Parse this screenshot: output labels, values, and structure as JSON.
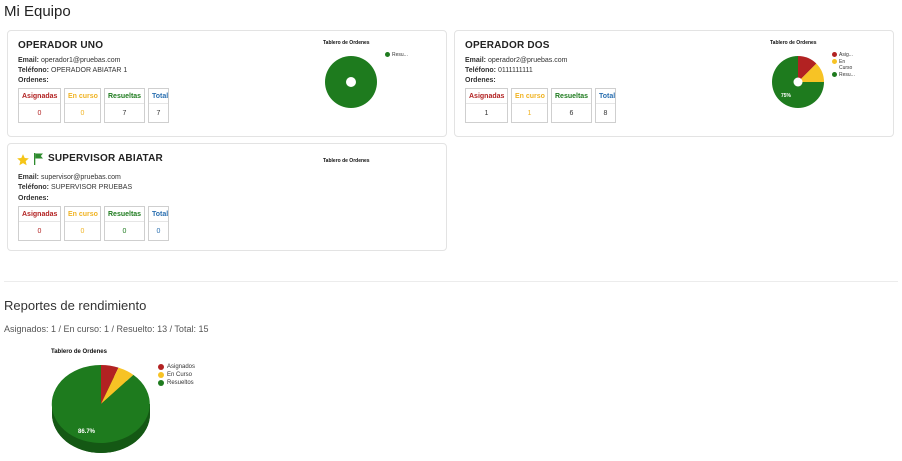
{
  "page": {
    "title": "Mi Equipo"
  },
  "labels": {
    "email": "Email:",
    "telefono": "Teléfono:",
    "ordenes": "Ordenes:",
    "asignadas": "Asignadas",
    "en_curso": "En curso",
    "resueltas": "Resueltas",
    "total": "Total"
  },
  "colors": {
    "asignados": "#b22222",
    "en_curso": "#f7c325",
    "resueltos": "#1e7b1e",
    "total": "#2a6fb0"
  },
  "operators": [
    {
      "name": "OPERADOR UNO",
      "email": "operador1@pruebas.com",
      "telefono": "OPERADOR ABIATAR 1",
      "asignadas": "0",
      "en_curso": "0",
      "resueltas": "7",
      "total": "7",
      "chart": {
        "title": "Tablero de Ordenes",
        "legend": [
          "Resu..."
        ],
        "pct_label": ""
      }
    },
    {
      "name": "OPERADOR DOS",
      "email": "operador2@pruebas.com",
      "telefono": "0111111111",
      "asignadas": "1",
      "en_curso": "1",
      "resueltas": "6",
      "total": "8",
      "chart": {
        "title": "Tablero de Ordenes",
        "legend": [
          "Asig...",
          "En Curso",
          "Resu..."
        ],
        "pct_label": "75%"
      }
    },
    {
      "name": "SUPERVISOR ABIATAR",
      "email": "supervisor@pruebas.com",
      "telefono": "SUPERVISOR PRUEBAS",
      "asignadas": "0",
      "en_curso": "0",
      "resueltas": "0",
      "total": "0",
      "chart": {
        "title": "Tablero de Ordenes",
        "legend": [],
        "pct_label": ""
      }
    }
  ],
  "reports": {
    "title": "Reportes de rendimiento",
    "summary": "Asignados: 1 / En curso: 1 / Resuelto: 13 / Total: 15"
  },
  "chart_data": [
    {
      "type": "pie",
      "title": "Tablero de Ordenes",
      "categories": [
        "Resueltos"
      ],
      "values": [
        7
      ]
    },
    {
      "type": "pie",
      "title": "Tablero de Ordenes",
      "categories": [
        "Asignados",
        "En Curso",
        "Resueltos"
      ],
      "values": [
        1,
        1,
        6
      ],
      "data_labels": [
        "75%"
      ]
    },
    {
      "type": "pie",
      "title": "Tablero de Ordenes",
      "categories": [],
      "values": []
    },
    {
      "type": "pie",
      "title": "Tablero de Ordenes",
      "categories": [
        "Asignados",
        "En Curso",
        "Resueltos"
      ],
      "values": [
        1,
        1,
        13
      ],
      "data_labels": [
        "86.7%"
      ],
      "legend_position": "right"
    }
  ]
}
